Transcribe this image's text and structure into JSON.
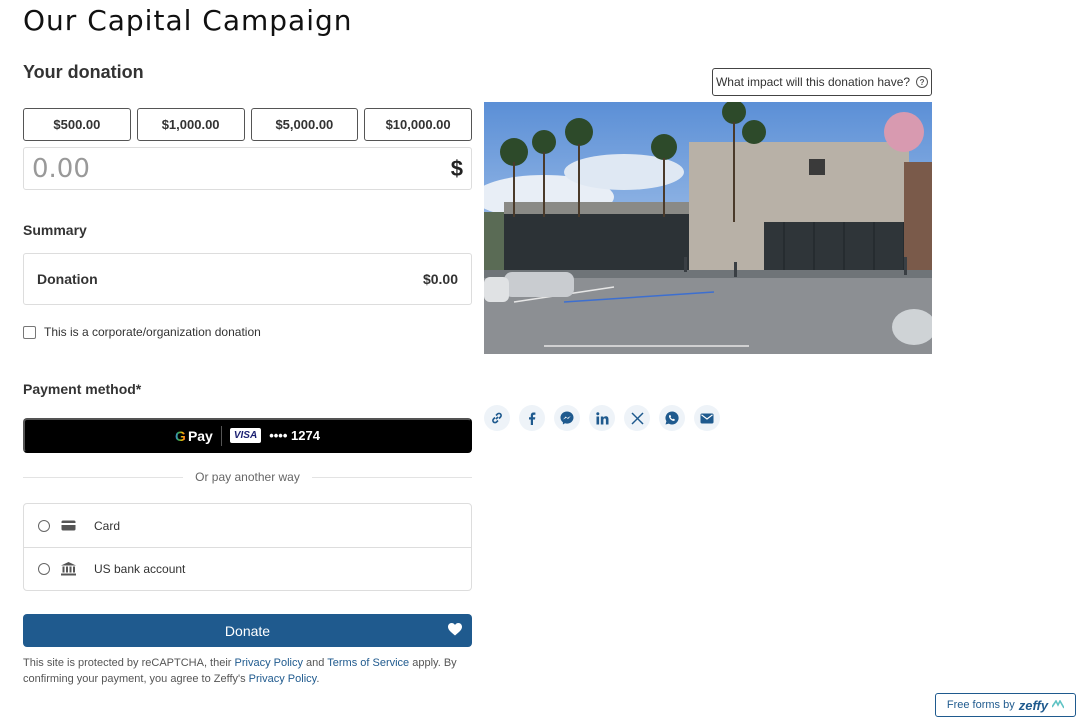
{
  "page": {
    "title": "Our Capital Campaign"
  },
  "donation": {
    "title": "Your donation",
    "impact_label": "What impact will this donation have?",
    "amounts": [
      "$500.00",
      "$1,000.00",
      "$5,000.00",
      "$10,000.00"
    ],
    "custom_value": "0.00",
    "currency": "$"
  },
  "summary": {
    "title": "Summary",
    "label": "Donation",
    "amount": "$0.00"
  },
  "corporate": {
    "label": "This is a corporate/organization donation"
  },
  "payment": {
    "title": "Payment method*",
    "gpay_brand": "Pay",
    "card_brand": "VISA",
    "card_last": "•••• 1274",
    "divider": "Or pay another way",
    "methods": [
      "Card",
      "US bank account"
    ]
  },
  "donate": {
    "label": "Donate"
  },
  "legal": {
    "part1": "This site is protected by reCAPTCHA, their ",
    "privacy1": "Privacy Policy",
    "and": " and ",
    "terms": "Terms of Service",
    "part2": " apply. By confirming your payment, you agree to Zeffy's ",
    "privacy2": "Privacy Policy",
    "end": "."
  },
  "badge": {
    "label": "Free forms by",
    "brand": "zeffy"
  },
  "icons": {
    "share": [
      "link-icon",
      "facebook-icon",
      "messenger-icon",
      "linkedin-icon",
      "x-icon",
      "whatsapp-icon",
      "email-icon"
    ]
  },
  "colors": {
    "primary": "#1f5a8e",
    "gpay_bg": "#000000"
  }
}
